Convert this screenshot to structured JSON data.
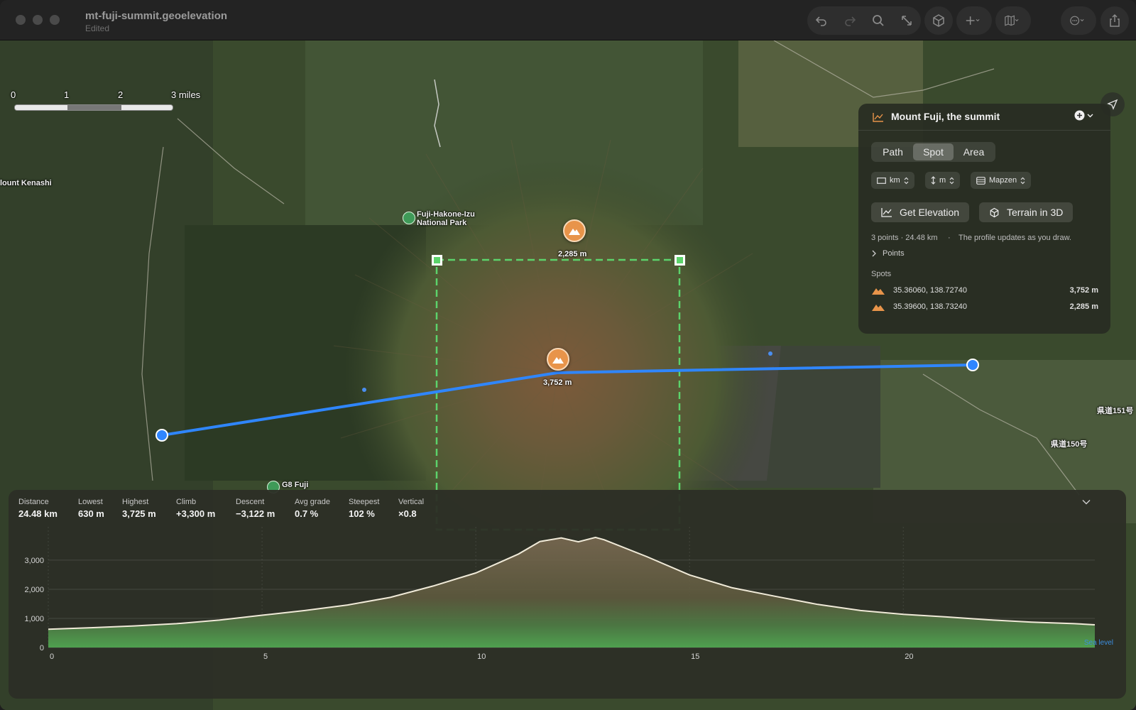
{
  "titlebar": {
    "title": "mt-fuji-summit.geoelevation",
    "subtitle": "Edited",
    "icons": [
      "undo-icon",
      "redo-icon",
      "search-icon",
      "resize-icon",
      "cube-icon",
      "plus-icon",
      "map-icon",
      "more-icon",
      "share-icon"
    ]
  },
  "map": {
    "scale": {
      "labels": [
        "0",
        "1",
        "2",
        "3 miles"
      ]
    },
    "places": [
      {
        "name": "lount Kenashi"
      },
      {
        "name": "Fuji-Hakone-Izu National Park"
      },
      {
        "name": "G8 Fuji"
      }
    ],
    "road_labels": [
      "県道151号",
      "県道150号"
    ],
    "spot_pins": [
      {
        "elevation_label": "2,285 m"
      },
      {
        "elevation_label": "3,752 m"
      }
    ],
    "route_color": "#2f86ff",
    "area_color": "#5cd36b",
    "pin_color": "#e8944a"
  },
  "panel": {
    "title": "Mount Fuji, the summit",
    "tabs": [
      {
        "label": "Path",
        "active": false
      },
      {
        "label": "Spot",
        "active": true
      },
      {
        "label": "Area",
        "active": false
      }
    ],
    "distance_unit": "km",
    "height_unit": "m",
    "source": "Mapzen",
    "get_elevation": "Get Elevation",
    "terrain_3d": "Terrain in 3D",
    "summary": "3 points · 24.48 km",
    "hint": "The profile updates as you draw.",
    "points_label": "Points",
    "spots_label": "Spots",
    "spots": [
      {
        "coords": "35.36060, 138.72740",
        "elevation": "3,752 m"
      },
      {
        "coords": "35.39600, 138.73240",
        "elevation": "2,285 m"
      }
    ]
  },
  "profile": {
    "stats": [
      {
        "label": "Distance",
        "value": "24.48 km"
      },
      {
        "label": "Lowest",
        "value": "630 m"
      },
      {
        "label": "Highest",
        "value": "3,725 m"
      },
      {
        "label": "Climb",
        "value": "+3,300 m"
      },
      {
        "label": "Descent",
        "value": "−3,122 m"
      },
      {
        "label": "Avg grade",
        "value": "0.7 %"
      },
      {
        "label": "Steepest",
        "value": "102 %"
      },
      {
        "label": "Vertical",
        "value": "×0.8"
      }
    ],
    "sea_level_label": "Sea level"
  },
  "chart_data": {
    "type": "area",
    "x": [
      0,
      1,
      2,
      3,
      4,
      5,
      6,
      7,
      8,
      9,
      10,
      11,
      11.5,
      12,
      12.4,
      12.8,
      13,
      14,
      15,
      16,
      17,
      18,
      19,
      20,
      21,
      22,
      23,
      24,
      24.48
    ],
    "y": [
      630,
      680,
      740,
      820,
      940,
      1110,
      1270,
      1460,
      1720,
      2110,
      2560,
      3210,
      3640,
      3760,
      3630,
      3780,
      3700,
      3120,
      2490,
      2050,
      1760,
      1480,
      1270,
      1140,
      1050,
      950,
      870,
      820,
      780
    ],
    "xlabel": "",
    "ylabel": "",
    "xlim": [
      0,
      24.48
    ],
    "ylim": [
      0,
      3900
    ],
    "x_ticks": [
      "0",
      "5",
      "10",
      "15",
      "20"
    ],
    "y_ticks": [
      "0",
      "1,000",
      "2,000",
      "3,000"
    ],
    "grid": true,
    "line_color": "#f0ead8"
  }
}
